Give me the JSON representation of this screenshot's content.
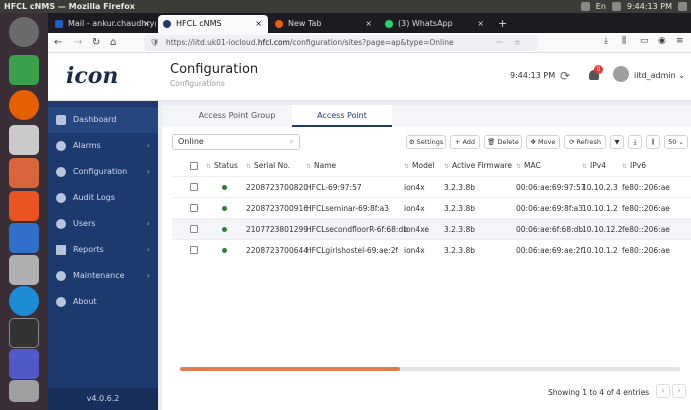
{
  "system": {
    "window_title": "HFCL cNMS — Mozilla Firefox",
    "time": "9:44:13 PM",
    "lang": "En"
  },
  "browser": {
    "tabs": [
      {
        "label": "Mail - ankur.chaudhry@",
        "color": "#1565c0"
      },
      {
        "label": "HFCL cNMS",
        "color": "#1d3a6e"
      },
      {
        "label": "New Tab",
        "color": "#e66000"
      },
      {
        "label": "(3) WhatsApp",
        "color": "#25d366"
      }
    ],
    "new_tab": "+",
    "url_prefix": "https://iitd.uk01-iocloud.",
    "url_domain": "hfcl.com",
    "url_suffix": "/configuration/sites?page=ap&type=Online",
    "url_dots": "···"
  },
  "app": {
    "logo": "icon",
    "title": "Configuration",
    "subtitle": "Configurations",
    "clock": "9:44:13 PM",
    "notif_count": "0",
    "user": "iitd_admin ⌄",
    "version": "v4.0.6.2"
  },
  "sidebar": {
    "items": [
      {
        "label": "Dashboard",
        "chev": ""
      },
      {
        "label": "Alarms",
        "chev": "›"
      },
      {
        "label": "Configuration",
        "chev": "›"
      },
      {
        "label": "Audit Logs",
        "chev": ""
      },
      {
        "label": "Users",
        "chev": "›"
      },
      {
        "label": "Reports",
        "chev": "›"
      },
      {
        "label": "Maintenance",
        "chev": "›"
      },
      {
        "label": "About",
        "chev": ""
      }
    ]
  },
  "page_tabs": [
    "Access Point Group",
    "Access Point"
  ],
  "toolbar": {
    "search_value": "Online",
    "settings": "⚙ Settings",
    "add": "+ Add",
    "delete": "🗑 Delete",
    "move": "✥ Move",
    "refresh": "⟳ Refresh",
    "page_size": "50 ⌄"
  },
  "table": {
    "columns": [
      "Status",
      "Serial No.",
      "Name",
      "Model",
      "Active Firmware",
      "MAC",
      "IPv4",
      "IPv6"
    ],
    "rows": [
      {
        "serial": "2208723700820",
        "name": "HFCL-69:97:57",
        "model": "ion4x",
        "firmware": "3.2.3.8b",
        "mac": "00:06:ae:69:97:57",
        "ipv4": "10.10.2.3",
        "ipv6": "fe80::206:ae"
      },
      {
        "serial": "2208723700916",
        "name": "HFCLseminar-69:8f:a3",
        "model": "ion4x",
        "firmware": "3.2.3.8b",
        "mac": "00:06:ae:69:8f:a3",
        "ipv4": "10.10.1.2",
        "ipv6": "fe80::206:ae"
      },
      {
        "serial": "2107723801299",
        "name": "HFCLsecondfloorR-6f:68:db",
        "model": "ion4xe",
        "firmware": "3.2.3.8b",
        "mac": "00:06:ae:6f:68:db",
        "ipv4": "10.10.12.2",
        "ipv6": "fe80::206:ae"
      },
      {
        "serial": "2208723700644",
        "name": "HFCLgirlshostel-69:ae:2f",
        "model": "ion4x",
        "firmware": "3.2.3.8b",
        "mac": "00:06:ae:69:ae:2f",
        "ipv4": "10.10.1.2",
        "ipv6": "fe80::206:ae"
      }
    ]
  },
  "footer": {
    "showing": "Showing 1 to 4 of 4 entries",
    "scroll_position": 0.44
  },
  "colors": {
    "sidebar": "#1d3a6e",
    "accent": "#e07a4f",
    "status_online": "#2e7d32"
  }
}
